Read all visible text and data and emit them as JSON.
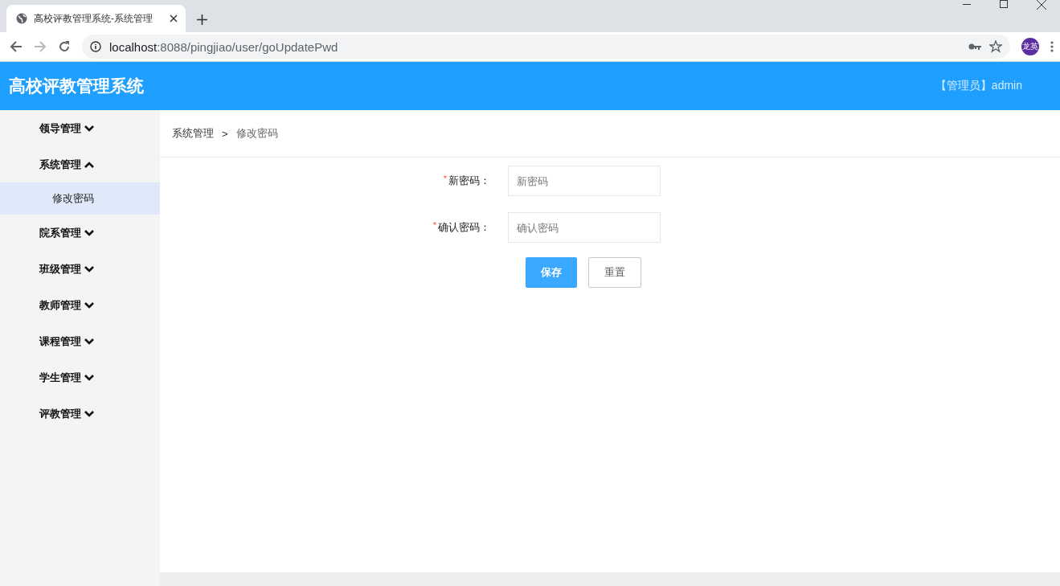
{
  "browser": {
    "tab_title": "高校评教管理系统-系统管理",
    "url_host": "localhost",
    "url_path": ":8088/pingjiao/user/goUpdatePwd",
    "profile": "龙英"
  },
  "header": {
    "title": "高校评教管理系统",
    "user": "【管理员】admin"
  },
  "sidebar": {
    "items": [
      {
        "label": "领导管理",
        "expanded": false
      },
      {
        "label": "系统管理",
        "expanded": true,
        "children": [
          {
            "label": "修改密码",
            "selected": true
          }
        ]
      },
      {
        "label": "院系管理",
        "expanded": false
      },
      {
        "label": "班级管理",
        "expanded": false
      },
      {
        "label": "教师管理",
        "expanded": false
      },
      {
        "label": "课程管理",
        "expanded": false
      },
      {
        "label": "学生管理",
        "expanded": false
      },
      {
        "label": "评教管理",
        "expanded": false
      }
    ]
  },
  "breadcrumb": {
    "items": [
      "系统管理",
      "修改密码"
    ],
    "separator": ">"
  },
  "form": {
    "fields": [
      {
        "label": "新密码：",
        "required": true,
        "required_mark": "*",
        "placeholder": "新密码"
      },
      {
        "label": "确认密码：",
        "required": true,
        "required_mark": "*",
        "placeholder": "确认密码"
      }
    ],
    "buttons": [
      {
        "label": "保存",
        "kind": "primary"
      },
      {
        "label": "重置",
        "kind": "default"
      }
    ]
  }
}
